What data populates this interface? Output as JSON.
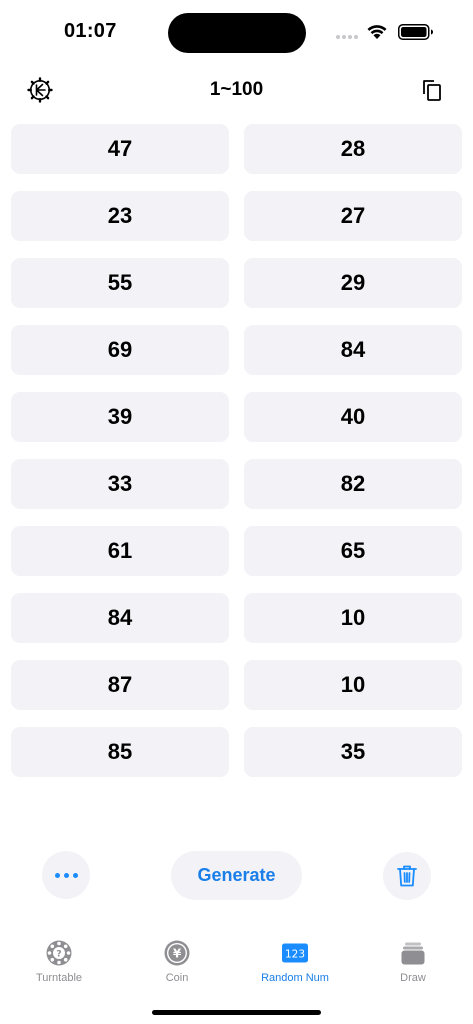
{
  "status_bar": {
    "time": "01:07"
  },
  "header": {
    "settings_icon": "settings-gear-icon",
    "title": "1~100",
    "copy_icon": "copy-icon"
  },
  "numbers": [
    [
      "47",
      "28"
    ],
    [
      "23",
      "27"
    ],
    [
      "55",
      "29"
    ],
    [
      "69",
      "84"
    ],
    [
      "39",
      "40"
    ],
    [
      "33",
      "82"
    ],
    [
      "61",
      "65"
    ],
    [
      "84",
      "10"
    ],
    [
      "87",
      "10"
    ],
    [
      "85",
      "35"
    ]
  ],
  "actions": {
    "more_icon": "ellipsis-icon",
    "generate_label": "Generate",
    "trash_icon": "trash-icon"
  },
  "tabs": [
    {
      "label": "Turntable",
      "icon": "turntable-icon",
      "active": false
    },
    {
      "label": "Coin",
      "icon": "coin-yen-icon",
      "active": false
    },
    {
      "label": "Random Num",
      "icon": "number-123-icon",
      "icon_text": "123",
      "active": true
    },
    {
      "label": "Draw",
      "icon": "draw-box-icon",
      "active": false
    }
  ],
  "colors": {
    "accent": "#1a7fe8",
    "cell_background": "#f2f2f7",
    "inactive_tab": "#8e8e93"
  }
}
